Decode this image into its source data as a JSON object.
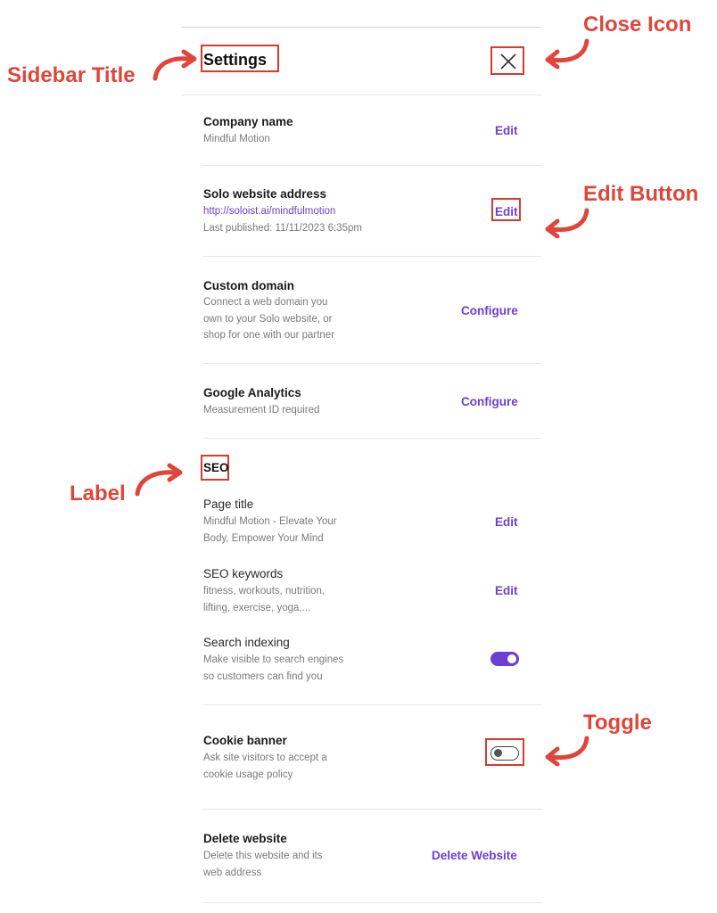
{
  "sidebar": {
    "title": "Settings",
    "rows": {
      "company": {
        "title": "Company name",
        "sub": "Mindful Motion",
        "action": "Edit"
      },
      "address": {
        "title": "Solo website address",
        "link": "http://soloist.ai/mindfulmotion",
        "sub": "Last published: 11/11/2023 6:35pm",
        "action": "Edit"
      },
      "domain": {
        "title": "Custom domain",
        "sub": [
          "Connect a web domain you",
          "own to your Solo website, or",
          "shop for one with our partner"
        ],
        "action": "Configure"
      },
      "analytics": {
        "title": "Google Analytics",
        "sub": "Measurement ID required",
        "action": "Configure"
      },
      "seo": {
        "label": "SEO",
        "page_title": {
          "title": "Page title",
          "sub": [
            "Mindful Motion - Elevate Your",
            "Body, Empower Your Mind"
          ],
          "action": "Edit"
        },
        "keywords": {
          "title": "SEO keywords",
          "sub": [
            "fitness, workouts, nutrition,",
            "lifting, exercise, yoga,..."
          ],
          "action": "Edit"
        },
        "indexing": {
          "title": "Search indexing",
          "sub": [
            "Make visible to search engines",
            "so customers can find you"
          ],
          "toggle_on": true
        }
      },
      "cookie": {
        "title": "Cookie banner",
        "sub": [
          "Ask site visitors to accept a",
          "cookie usage policy"
        ],
        "toggle_on": false
      },
      "delete": {
        "title": "Delete website",
        "sub": [
          "Delete this website and its",
          "web address"
        ],
        "action": "Delete Website"
      }
    }
  },
  "annotations": {
    "sidebar_title": "Sidebar Title",
    "close_icon": "Close Icon",
    "edit_button": "Edit Button",
    "label": "Label",
    "toggle": "Toggle"
  },
  "colors": {
    "accent": "#6b3fd4",
    "annotation": "#e0453a",
    "highlight_box": "#d83a2e"
  },
  "icons": {
    "close": "close-icon",
    "arrow": "curved-arrow-icon"
  }
}
